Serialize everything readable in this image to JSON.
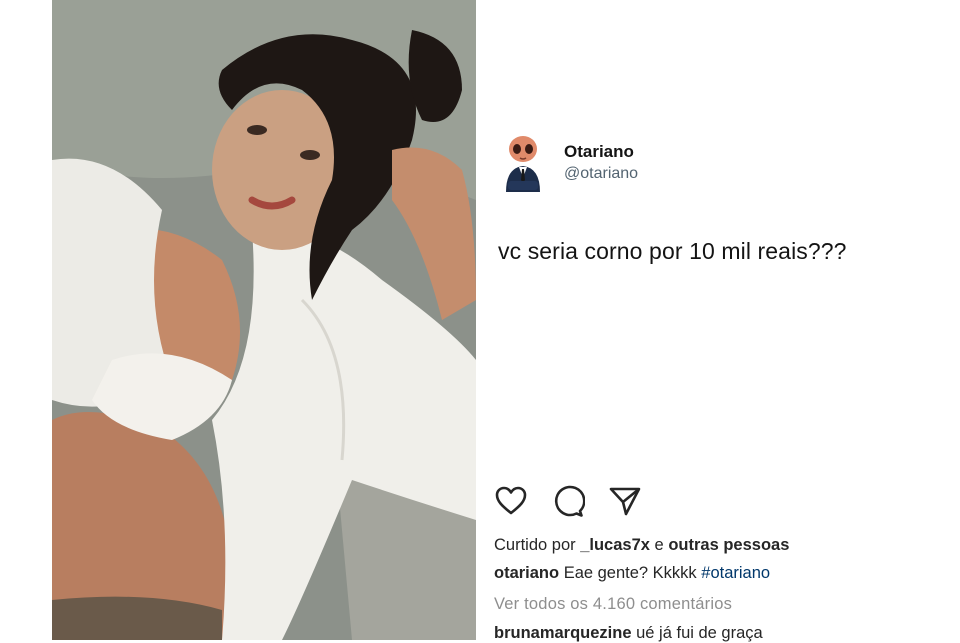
{
  "tweet": {
    "author_name": "Otariano",
    "author_handle": "@otariano",
    "text": "vc seria corno por 10 mil reais???"
  },
  "post": {
    "actions": {
      "like_icon": "heart-icon",
      "comment_icon": "comment-icon",
      "share_icon": "paper-plane-icon"
    },
    "likes": {
      "prefix": "Curtido por",
      "user": "_lucas7x",
      "joiner": "e",
      "others": "outras pessoas"
    },
    "caption": {
      "user": "otariano",
      "text": "Eae gente? Kkkkk",
      "hashtag": "#otariano"
    },
    "view_comments": "Ver todos os 4.160 comentários",
    "comment": {
      "user": "brunamarquezine",
      "text": "ué já fui de graça"
    },
    "colors": {
      "text": "#262626",
      "muted": "#8e8e8e",
      "hashtag": "#00376b",
      "handle": "#536471"
    }
  }
}
